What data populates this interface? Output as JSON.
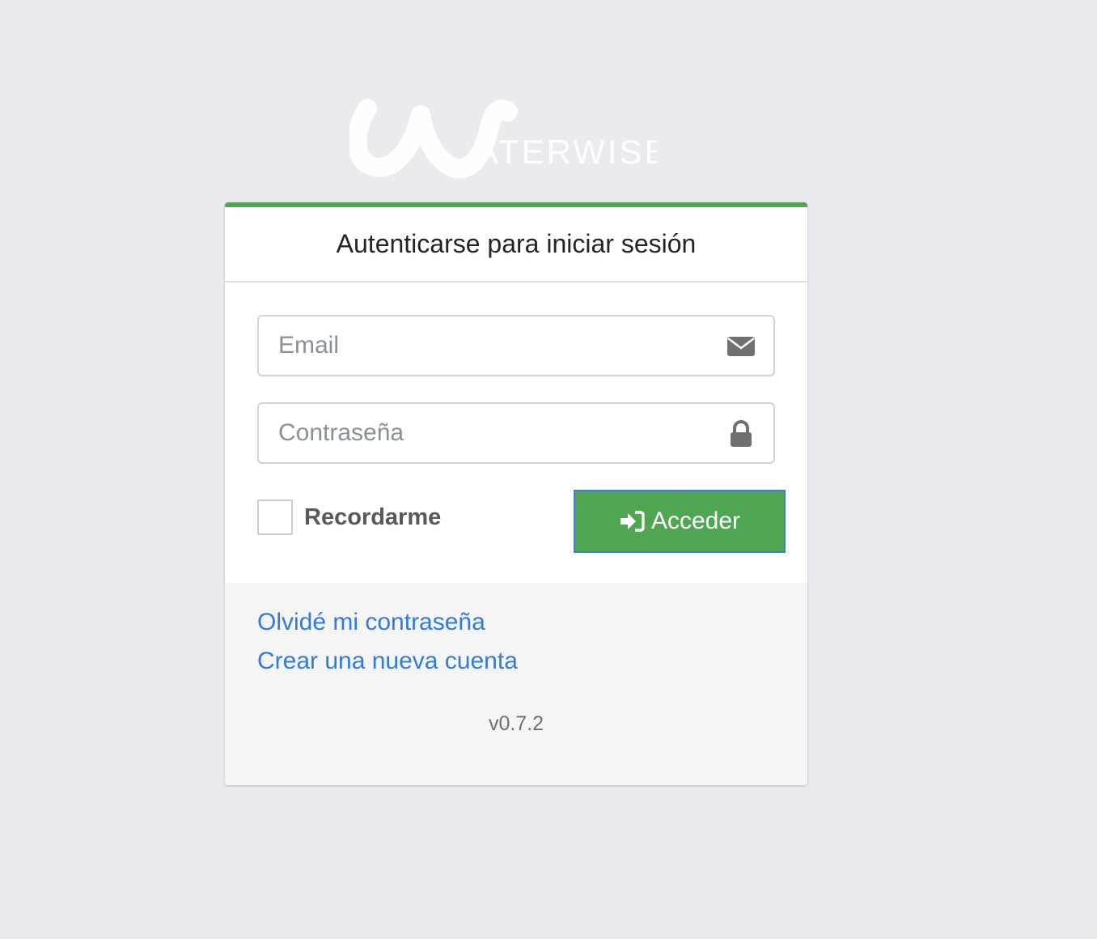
{
  "brand": {
    "logo_text": "ATERWISE",
    "logo_icon": "waterwise-w-logo"
  },
  "login": {
    "title": "Autenticarse para iniciar sesión",
    "email": {
      "placeholder": "Email",
      "value": "",
      "icon": "envelope-icon"
    },
    "password": {
      "placeholder": "Contraseña",
      "value": "",
      "icon": "lock-icon"
    },
    "remember": {
      "label": "Recordarme",
      "checked": false
    },
    "submit": {
      "label": "Acceder",
      "icon": "sign-in-icon"
    }
  },
  "footer": {
    "forgot_password": "Olvidé mi contraseña",
    "register": "Crear una nueva cuenta",
    "version": "v0.7.2"
  },
  "colors": {
    "background": "#e9ebee",
    "accent": "#51a653",
    "link": "#2f7be0"
  }
}
